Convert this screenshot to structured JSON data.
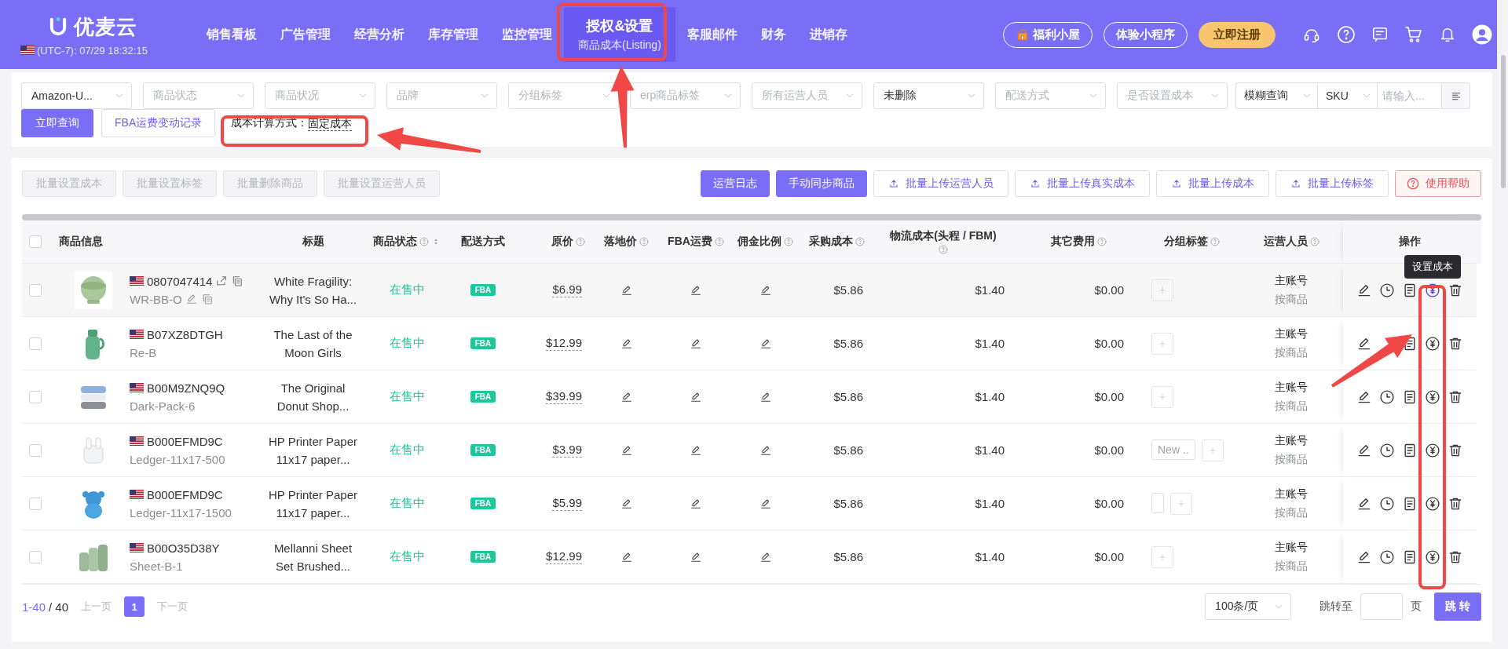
{
  "header": {
    "logo": "优麦云",
    "clock": "(UTC-7): 07/29 18:32:15",
    "nav": [
      {
        "label": "销售看板",
        "selected": false
      },
      {
        "label": "广告管理",
        "selected": false
      },
      {
        "label": "经营分析",
        "selected": false
      },
      {
        "label": "库存管理",
        "selected": false
      },
      {
        "label": "监控管理",
        "selected": false
      },
      {
        "label": "授权&设置",
        "selected": true,
        "sub": "商品成本(Listing)"
      },
      {
        "label": "客服邮件",
        "selected": false
      },
      {
        "label": "财务",
        "selected": false
      },
      {
        "label": "进销存",
        "selected": false
      }
    ],
    "actions": [
      {
        "label": "福利小屋",
        "kind": "house"
      },
      {
        "label": "体验小程序",
        "kind": "outline"
      },
      {
        "label": "立即注册",
        "kind": "gold"
      }
    ]
  },
  "filters": {
    "selects": [
      {
        "value": "Amazon-U..."
      },
      {
        "placeholder": "商品状态"
      },
      {
        "placeholder": "商品状况"
      },
      {
        "placeholder": "品牌"
      },
      {
        "placeholder": "分组标签"
      },
      {
        "placeholder": "erp商品标签"
      },
      {
        "placeholder": "所有运营人员"
      },
      {
        "value": "未删除"
      },
      {
        "placeholder": "配送方式"
      },
      {
        "placeholder": "是否设置成本"
      }
    ],
    "search": {
      "mode": "模糊查询",
      "field": "SKU",
      "placeholder": "请输入..."
    },
    "query_button": "立即查询",
    "log_button": "FBA运费变动记录",
    "cost_method": {
      "label": "成本计算方式：",
      "value": "固定成本"
    }
  },
  "toolbar": {
    "left": [
      {
        "label": "批量设置成本",
        "disabled": true
      },
      {
        "label": "批量设置标签",
        "disabled": true
      },
      {
        "label": "批量删除商品",
        "disabled": true
      },
      {
        "label": "批量设置运营人员",
        "disabled": true
      }
    ],
    "right": [
      {
        "label": "运营日志",
        "kind": "primary"
      },
      {
        "label": "手动同步商品",
        "kind": "primary"
      },
      {
        "label": "批量上传运营人员",
        "kind": "upload"
      },
      {
        "label": "批量上传真实成本",
        "kind": "upload"
      },
      {
        "label": "批量上传成本",
        "kind": "upload"
      },
      {
        "label": "批量上传标签",
        "kind": "upload"
      },
      {
        "label": "使用帮助",
        "kind": "help"
      }
    ]
  },
  "table": {
    "select_all_checked": false,
    "columns": [
      {
        "label": "商品信息",
        "help": false,
        "sortable": false
      },
      {
        "label": "标题",
        "help": false,
        "sortable": false
      },
      {
        "label": "商品状态",
        "help": true,
        "sortable": true
      },
      {
        "label": "配送方式",
        "help": false,
        "sortable": false
      },
      {
        "label": "原价",
        "help": true,
        "sortable": false
      },
      {
        "label": "落地价",
        "help": true,
        "sortable": false
      },
      {
        "label": "FBA运费",
        "help": true,
        "sortable": false
      },
      {
        "label": "佣金比例",
        "help": true,
        "sortable": false
      },
      {
        "label": "采购成本",
        "help": true,
        "sortable": false
      },
      {
        "label": "物流成本(头程 / FBM)",
        "help": true,
        "sortable": false
      },
      {
        "label": "其它费用",
        "help": true,
        "sortable": false
      },
      {
        "label": "分组标签",
        "help": true,
        "sortable": false
      },
      {
        "label": "运营人员",
        "help": true,
        "sortable": false
      },
      {
        "label": "操作",
        "help": false,
        "sortable": false
      }
    ],
    "rows": [
      {
        "checked": false,
        "hovered": true,
        "asin": "0807047414",
        "sku": "WR-BB-O",
        "title": "White Fragility: Why It's So Ha...",
        "status": "在售中",
        "fulfillment": "FBA",
        "price": "$6.99",
        "purchase_cost": "$5.86",
        "logistics_cost": "$1.40",
        "other_fees": "$0.00",
        "tags": [],
        "operator": "主账号",
        "operator_mode": "按商品",
        "tooltip": "设置成本"
      },
      {
        "checked": false,
        "hovered": false,
        "asin": "B07XZ8DTGH",
        "sku": "Re-B",
        "title": "The Last of the Moon Girls",
        "status": "在售中",
        "fulfillment": "FBA",
        "price": "$12.99",
        "purchase_cost": "$5.86",
        "logistics_cost": "$1.40",
        "other_fees": "$0.00",
        "tags": [],
        "operator": "主账号",
        "operator_mode": "按商品"
      },
      {
        "checked": false,
        "hovered": false,
        "asin": "B00M9ZNQ9Q",
        "sku": "Dark-Pack-6",
        "title": "The Original Donut Shop...",
        "status": "在售中",
        "fulfillment": "FBA",
        "price": "$39.99",
        "purchase_cost": "$5.86",
        "logistics_cost": "$1.40",
        "other_fees": "$0.00",
        "tags": [],
        "operator": "主账号",
        "operator_mode": "按商品"
      },
      {
        "checked": false,
        "hovered": false,
        "asin": "B000EFMD9C",
        "sku": "Ledger-11x17-500",
        "title": "HP Printer Paper 11x17 paper...",
        "status": "在售中",
        "fulfillment": "FBA",
        "price": "$3.99",
        "purchase_cost": "$5.86",
        "logistics_cost": "$1.40",
        "other_fees": "$0.00",
        "tags": [
          {
            "kind": "text",
            "label": "New .."
          }
        ],
        "operator": "主账号",
        "operator_mode": "按商品"
      },
      {
        "checked": false,
        "hovered": false,
        "asin": "B000EFMD9C",
        "sku": "Ledger-11x17-1500",
        "title": "HP Printer Paper 11x17 paper...",
        "status": "在售中",
        "fulfillment": "FBA",
        "price": "$5.99",
        "purchase_cost": "$5.86",
        "logistics_cost": "$1.40",
        "other_fees": "$0.00",
        "tags": [
          {
            "kind": "blank"
          }
        ],
        "operator": "主账号",
        "operator_mode": "按商品"
      },
      {
        "checked": false,
        "hovered": false,
        "asin": "B00O35D38Y",
        "sku": "Sheet-B-1",
        "title": "Mellanni Sheet Set Brushed...",
        "status": "在售中",
        "fulfillment": "FBA",
        "price": "$12.99",
        "purchase_cost": "$5.86",
        "logistics_cost": "$1.40",
        "other_fees": "$0.00",
        "tags": [],
        "operator": "主账号",
        "operator_mode": "按商品"
      }
    ]
  },
  "pagination": {
    "range": "1-40",
    "total": "/ 40",
    "prev": {
      "label": "上一页",
      "disabled": true
    },
    "pages": [
      {
        "label": "1",
        "selected": true
      }
    ],
    "next": {
      "label": "下一页",
      "disabled": true
    },
    "page_size": "100条/页",
    "jump_label": "跳转至",
    "jump_unit": "页",
    "jump_button": "跳 转"
  }
}
